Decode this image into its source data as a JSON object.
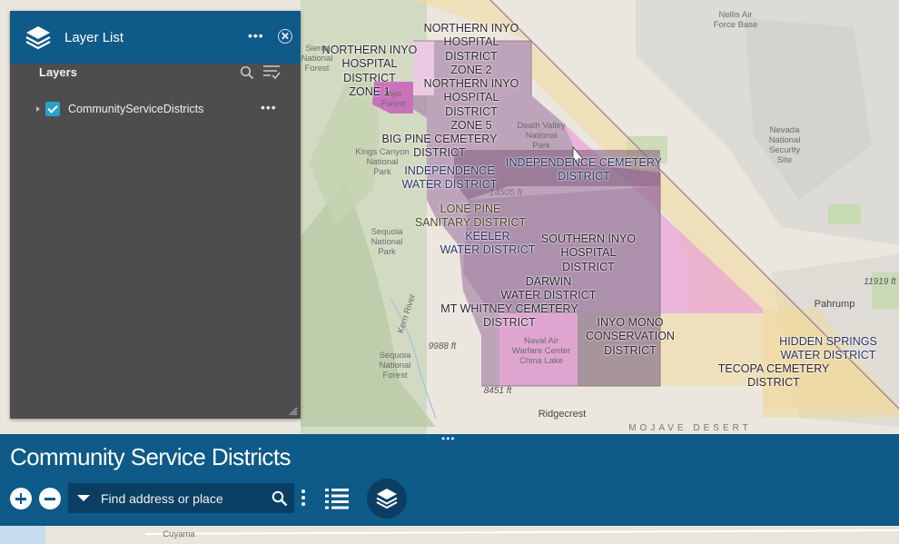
{
  "panel": {
    "title": "Layer List",
    "section_heading": "Layers",
    "more_label": "•••",
    "layers": [
      {
        "name": "CommunityServiceDistricts",
        "visible": true,
        "more_label": "•••"
      }
    ]
  },
  "app": {
    "title": "Community Service Districts",
    "drag_handle": "•••",
    "search": {
      "placeholder": "Find address or place",
      "value": ""
    },
    "accent_color": "#0e5a88",
    "dark_accent_color": "#0a3f63"
  },
  "map": {
    "district_labels": [
      "NORTHERN INYO\nHOSPITAL\nDISTRICT\nZONE 2",
      "NORTHERN INYO\nHOSPITAL\nDISTRICT\nZONE 1",
      "NORTHERN INYO\nHOSPITAL\nDISTRICT\nZONE 5",
      "BIG PINE CEMETERY\nDISTRICT",
      "INDEPENDENCE CEMETERY\nDISTRICT",
      "INDEPENDENCE\nWATER DISTRICT",
      "LONE PINE\nSANITARY DISTRICT",
      "KEELER\nWATER DISTRICT",
      "SOUTHERN INYO\nHOSPITAL\nDISTRICT",
      "DARWIN\nWATER DISTRICT",
      "MT WHITNEY CEMETERY\nDISTRICT",
      "INYO MONO\nCONSERVATION\nDISTRICT",
      "HIDDEN SPRINGS\nWATER DISTRICT",
      "TECOPA CEMETERY\nDISTRICT"
    ],
    "place_labels": [
      "Nellis Air\nForce Base",
      "Nevada\nNational\nSecurity\nSite",
      "Death Valley\nNational\nPark",
      "Kings Canyon\nNational\nPark",
      "Sequoia\nNational\nPark",
      "Sequoia\nNational\nForest",
      "Naval Air\nWarfare Center\nChina Lake",
      "Pahrump",
      "Ridgecrest",
      "Sierra\nNational\nForest",
      "Inyo\nForest",
      "Kern River"
    ],
    "elevation_labels": [
      "11919 ft",
      "9988 ft",
      "8451 ft",
      "14505 ft"
    ],
    "road_label": "MOJAVE DESERT",
    "bottom_labels": [
      "Cuyama"
    ],
    "icons": [
      "layers-icon",
      "search-icon",
      "filter-icon",
      "zoom-in-icon",
      "zoom-out-icon",
      "legend-icon"
    ]
  }
}
